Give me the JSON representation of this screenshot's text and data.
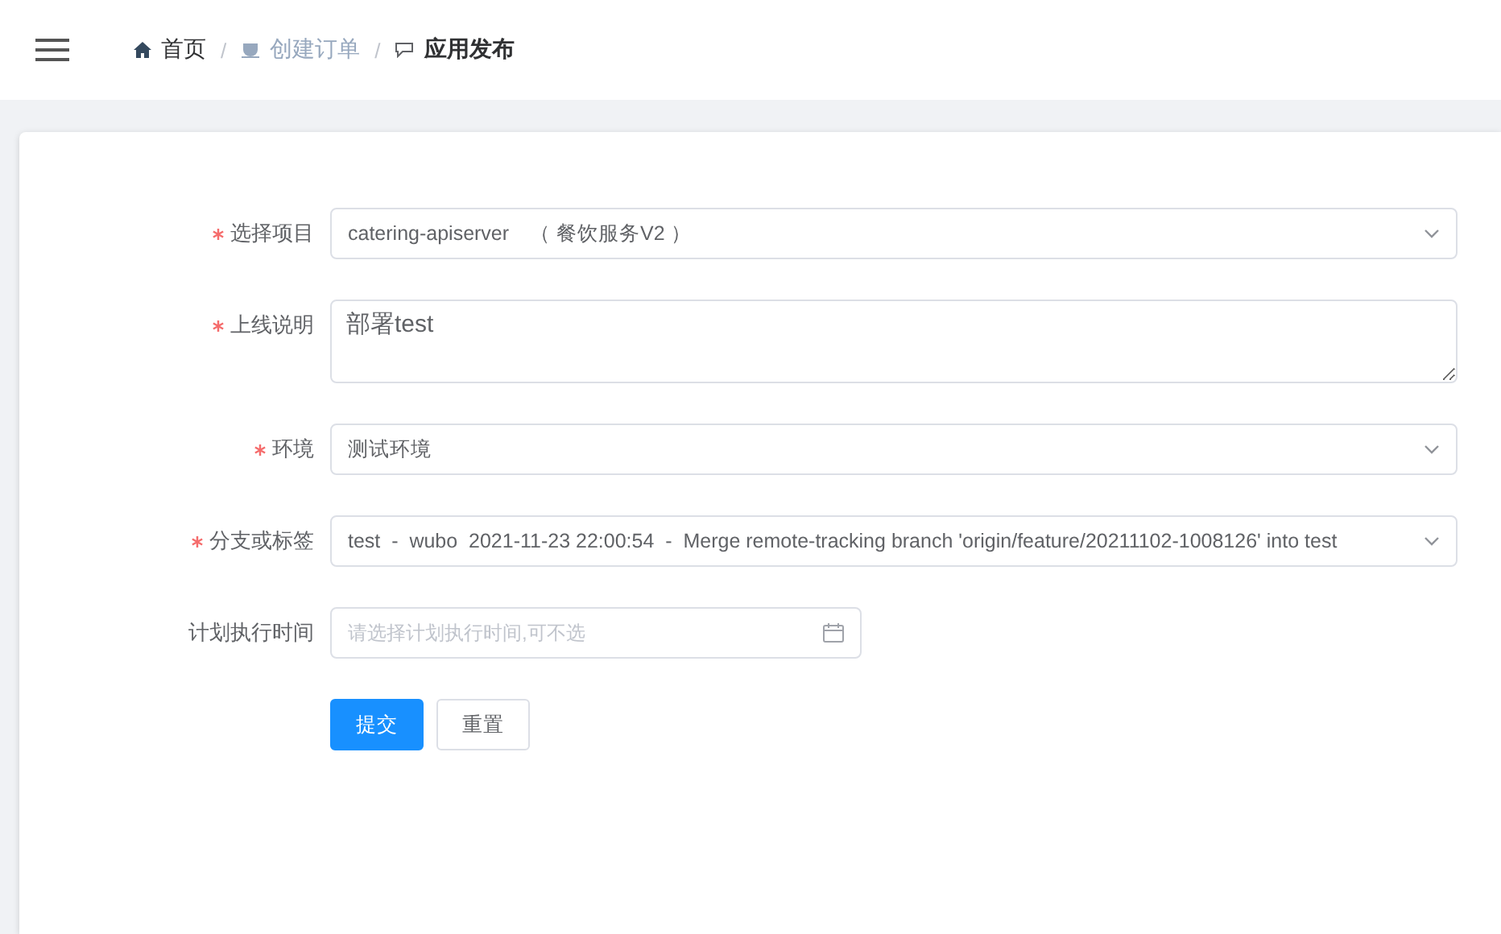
{
  "breadcrumb": [
    {
      "kind": "home",
      "label": "首页",
      "selected": false,
      "disabled": false
    },
    {
      "kind": "cup",
      "separator": "/",
      "label": "创建订单",
      "selected": false,
      "disabled": true
    },
    {
      "kind": "chat",
      "separator": "/",
      "label": "应用发布",
      "selected": true,
      "disabled": false
    }
  ],
  "form": {
    "fields": [
      {
        "kind": "select",
        "label": "选择项目",
        "required": true,
        "value": "catering-apiserver　（ 餐饮服务V2 ）"
      },
      {
        "kind": "textarea",
        "label": "上线说明",
        "required": true,
        "value": "部署test"
      },
      {
        "kind": "select",
        "label": "环境",
        "required": true,
        "value": "测试环境"
      },
      {
        "kind": "select",
        "label": "分支或标签",
        "required": true,
        "value": "test  -  wubo  2021-11-23 22:00:54  -  Merge remote-tracking branch 'origin/feature/20211102-1008126' into test"
      },
      {
        "kind": "date",
        "label": "计划执行时间",
        "required": false,
        "placeholder": "请选择计划执行时间,可不选"
      }
    ],
    "buttons": [
      {
        "kind": "primary",
        "label": "提交"
      },
      {
        "kind": "default",
        "label": "重置"
      }
    ]
  }
}
